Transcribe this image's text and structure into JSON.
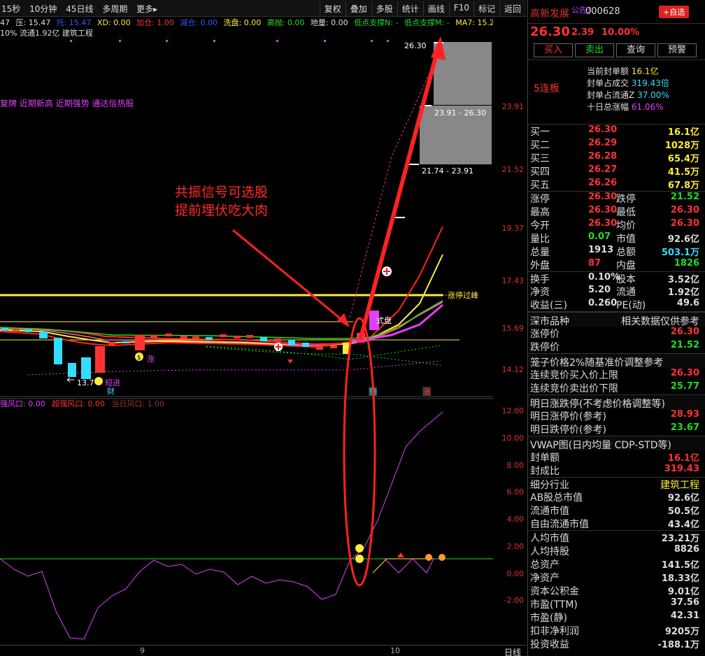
{
  "toolbar": {
    "left": [
      "15秒",
      "10分钟",
      "45日线",
      "多周期",
      "更多▸"
    ],
    "right": [
      "复权",
      "叠加",
      "多股",
      "统计",
      "画线",
      "F10",
      "标记",
      "返回"
    ]
  },
  "indicators": [
    {
      "text": "47",
      "color": "#ddd"
    },
    {
      "text": "压: 15.47",
      "color": "#ddd"
    },
    {
      "text": "托: 15.47",
      "color": "#3355ff"
    },
    {
      "text": "XD: 0.00",
      "color": "#ffeb3b"
    },
    {
      "text": "加仓: 1.00",
      "color": "#ff3333"
    },
    {
      "text": "减仓: 0.00",
      "color": "#3355ff"
    },
    {
      "text": "洗盘: 0.00",
      "color": "#ffeb3b"
    },
    {
      "text": "高抛: 0.00",
      "color": "#22dd22"
    },
    {
      "text": "地量: 0.00",
      "color": "#ddd"
    },
    {
      "text": "低点支撑N: -",
      "color": "#22dd22"
    },
    {
      "text": "低点支撑M: -",
      "color": "#22dd22"
    },
    {
      "text": "MA7: 15.2◇",
      "color": "#ffeb3b"
    }
  ],
  "info": "10% 流通1.92亿 建筑工程",
  "tagline": "复牌 近期新高 近期强势 通达信热股",
  "annotation": {
    "line1": "共振信号可选股",
    "line2": "提前埋伏吃大肉"
  },
  "chart_labels": {
    "breakout": "涨停过峰",
    "box_top": "23.91 - 26.30",
    "box_bottom": "21.74 - 23.91",
    "top_price": "26.30",
    "low_price": "13.7",
    "signal_fa": "式盘",
    "sig_zhang": "涨",
    "sig_jin": "短进",
    "sig_cai": "财",
    "sig_sui": "随",
    "sig_zhang2": "涨"
  },
  "yaxis_main": [
    "26.30",
    "23.91",
    "21.52",
    "19.37",
    "17.43",
    "15.69",
    "14.12"
  ],
  "sub_indicators": [
    {
      "text": "强风口: 0.00",
      "color": "#e040fb"
    },
    {
      "text": "超强风口: 0.00",
      "color": "#ff3333"
    },
    {
      "text": "当日风口: 1.00",
      "color": "#993333"
    }
  ],
  "yaxis_sub": [
    "12.00",
    "10.00",
    "8.00",
    "6.00",
    "4.00",
    "2.00",
    "0.00",
    "-2.00"
  ],
  "bottom": {
    "d1": "9",
    "d2": "10",
    "period": "日线"
  },
  "panel": {
    "name": "高新发展",
    "ann": "公告3",
    "code": "000628",
    "add": "+自选",
    "price": "26.30",
    "change": "2.39",
    "pct": "10.00%",
    "buttons": [
      "买入",
      "卖出",
      "查询",
      "预警"
    ],
    "limit_label": "5连板",
    "limit_rows": [
      {
        "k": "当前封单额",
        "v": "16.1亿",
        "kc": "#ddd",
        "vc": "#ffeb3b"
      },
      {
        "k": "封单占成交",
        "v": "319.43倍",
        "kc": "#ddd",
        "vc": "#33ddff"
      },
      {
        "k": "封单占流通Z",
        "v": "37.00%",
        "kc": "#ddd",
        "vc": "#33ddff"
      },
      {
        "k": "十日总涨幅",
        "v": "61.06%",
        "kc": "#ddd",
        "vc": "#e040fb"
      }
    ],
    "book": [
      {
        "k": "买一",
        "p": "26.30",
        "q": "16.1亿"
      },
      {
        "k": "买二",
        "p": "26.29",
        "q": "1028万"
      },
      {
        "k": "买三",
        "p": "26.28",
        "q": "65.4万"
      },
      {
        "k": "买四",
        "p": "26.27",
        "q": "41.5万"
      },
      {
        "k": "买五",
        "p": "26.26",
        "q": "67.8万"
      }
    ],
    "stats": [
      {
        "a": "涨停",
        "av": "26.30",
        "avc": "#ff3333",
        "b": "跌停",
        "bv": "21.52",
        "bvc": "#22dd22"
      },
      {
        "a": "最高",
        "av": "26.30",
        "avc": "#ff3333",
        "b": "最低",
        "bv": "26.30",
        "bvc": "#ff3333"
      },
      {
        "a": "今开",
        "av": "26.30",
        "avc": "#ff3333",
        "b": "均价",
        "bv": "26.30",
        "bvc": "#ff3333"
      },
      {
        "a": "量比",
        "av": "0.07",
        "avc": "#22dd22",
        "b": "市值",
        "bv": "92.6亿",
        "bvc": "#ddd"
      },
      {
        "a": "总量",
        "av": "1913",
        "avc": "#ddd",
        "b": "总额",
        "bv": "503.1万",
        "bvc": "#33ddff"
      },
      {
        "a": "外盘",
        "av": "87",
        "avc": "#ff3333",
        "b": "内盘",
        "bv": "1826",
        "bvc": "#22dd22"
      },
      {
        "a": "换手",
        "av": "0.10%",
        "avc": "#ddd",
        "b": "股本",
        "bv": "3.52亿",
        "bvc": "#ddd"
      },
      {
        "a": "净资",
        "av": "5.20",
        "avc": "#ddd",
        "b": "流通",
        "bv": "1.92亿",
        "bvc": "#ddd"
      },
      {
        "a": "收益(三)",
        "av": "0.260",
        "avc": "#ddd",
        "b": "PE(动)",
        "bv": "49.6",
        "bvc": "#ddd"
      }
    ],
    "sec1": {
      "a": "深市品种",
      "b": "相关数据仅供参考"
    },
    "limits": [
      {
        "k": "涨停价",
        "v": "26.30",
        "c": "#ff3333"
      },
      {
        "k": "跌停价",
        "v": "21.52",
        "c": "#22dd22"
      }
    ],
    "sec2": "笼子价格2%随基准价调整参考",
    "cage": [
      {
        "k": "连续竞价买入价上限",
        "v": "26.30",
        "c": "#ff3333"
      },
      {
        "k": "连续竞价卖出价下限",
        "v": "25.77",
        "c": "#22dd22"
      }
    ],
    "sec3": "明日涨跌停(不考虑价格调整等)",
    "tomorrow": [
      {
        "k": "明日涨停价(参考)",
        "v": "28.93",
        "c": "#ff3333"
      },
      {
        "k": "明日跌停价(参考)",
        "v": "23.67",
        "c": "#22dd22"
      }
    ],
    "sec4": "VWAP图(日内均量 CDP-STD等)",
    "misc": [
      {
        "k": "封单额",
        "v": "16.1亿",
        "c": "#ff3333"
      },
      {
        "k": "封成比",
        "v": "319.43",
        "c": "#ff3333"
      }
    ],
    "industry": {
      "k": "细分行业",
      "v": "建筑工程"
    },
    "fund": [
      {
        "k": "AB股总市值",
        "v": "92.6亿"
      },
      {
        "k": "流通市值",
        "v": "50.5亿"
      },
      {
        "k": "自由流通市值",
        "v": "43.4亿"
      }
    ],
    "fin": [
      {
        "k": "人均市值",
        "v": "23.21万"
      },
      {
        "k": "人均持股",
        "v": "8826"
      },
      {
        "k": "总资产",
        "v": "141.5亿"
      },
      {
        "k": "净资产",
        "v": "18.33亿"
      },
      {
        "k": "资本公积金",
        "v": "9.01亿"
      },
      {
        "k": "市盈(TTM)",
        "v": "37.56"
      },
      {
        "k": "市盈(静)",
        "v": "42.31"
      },
      {
        "k": "扣非净利润",
        "v": "9205万"
      },
      {
        "k": "投资收益",
        "v": "-188.1万"
      }
    ]
  }
}
